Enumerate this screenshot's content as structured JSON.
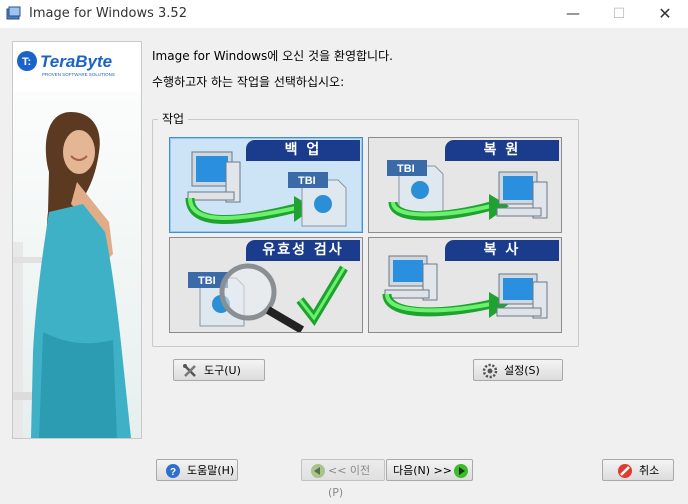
{
  "window": {
    "title": "Image for Windows 3.52",
    "minimize_glyph": "—",
    "maximize_glyph": "☐",
    "close_glyph": "✕"
  },
  "brand": {
    "logo_text": "TeraByte",
    "logo_tagline": "PROVEN SOFTWARE SOLUTIONS"
  },
  "main": {
    "welcome": "Image for Windows에 오신 것을 환영합니다.",
    "instruction": "수행하고자 하는 작업을 선택하십시오:"
  },
  "tasks": {
    "group_label": "작업",
    "backup": {
      "label": "백 업",
      "badge": "TBI",
      "selected": true
    },
    "restore": {
      "label": "복 원",
      "badge": "TBI"
    },
    "validate": {
      "label": "유효성 검사",
      "badge": "TBI"
    },
    "copy": {
      "label": "복 사"
    }
  },
  "buttons": {
    "tools": "도구(U)",
    "settings": "설정(S)",
    "help": "도움말(H)",
    "back": "<< 이전(P)",
    "next": "다음(N) >>",
    "cancel": "취소"
  },
  "colors": {
    "task_header": "#1b3c8c",
    "selected_bg": "#cde4f7",
    "arrow_green": "#2ecc40"
  }
}
